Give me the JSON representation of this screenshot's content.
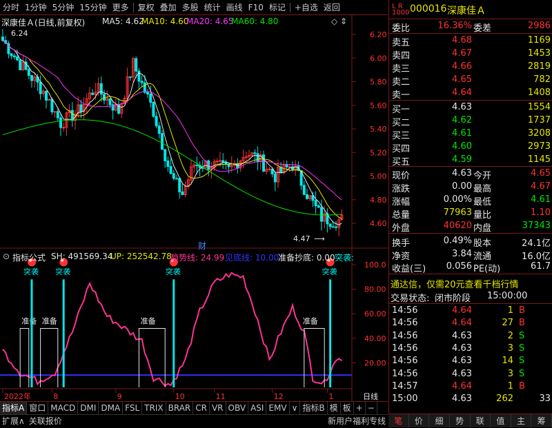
{
  "toolbar": {
    "items": [
      "分时",
      "1分钟",
      "5分钟",
      "15分钟",
      "更多",
      "复权",
      "叠加",
      "多股",
      "统计",
      "画线",
      "F10",
      "标记",
      "+自选",
      "返回"
    ]
  },
  "main_chart": {
    "title": "深康佳Ａ(日线,前复权)",
    "ma5": "MA5: 4.62",
    "ma10": "MA10: 4.60",
    "ma20": "MA20: 4.65",
    "ma60": "MA60: 4.80",
    "high_marker": "6.24",
    "low_marker": "4.47",
    "fin_marker": "财",
    "y_ticks": [
      "6.20",
      "6.00",
      "5.80",
      "5.60",
      "5.40",
      "5.20",
      "5.00",
      "4.80",
      "4.60"
    ]
  },
  "indicator": {
    "name": "指标公式",
    "sh": "SH: 491569.34",
    "up": "UP: 252542.78",
    "trend": "趋势线: 24.99",
    "bottom": "见底线: 10.00",
    "prep": "准备抄底: 0.00",
    "breakout": "突袭:",
    "signal_breakout": "突袭",
    "signal_prep": "准备",
    "y_ticks": [
      "100.0",
      "80.00",
      "60.00",
      "40.00",
      "20.00"
    ]
  },
  "x_axis": {
    "labels": [
      "2022年",
      "8",
      "9",
      "10",
      "11",
      "12",
      "1"
    ],
    "period": "日线"
  },
  "tabs_row1": [
    "指标A",
    "窗口",
    "MACD",
    "DMI",
    "DMA",
    "FSL",
    "TRIX",
    "BRAR",
    "CR",
    "VR",
    "OBV",
    "ASI",
    "EMV",
    "∨",
    "指标B",
    "模",
    "板",
    "+",
    "−"
  ],
  "tabs_row2": [
    "扩展∧",
    "关联报价",
    "新用户福利专线"
  ],
  "panel": {
    "code": "000016",
    "name": "深康佳Ａ",
    "weibi_label": "委比",
    "weibi": "16.36%",
    "weicha_label": "委差",
    "weicha": "2986",
    "sells": [
      {
        "label": "卖五",
        "price": "4.68",
        "vol": "1169"
      },
      {
        "label": "卖四",
        "price": "4.67",
        "vol": "1453"
      },
      {
        "label": "卖三",
        "price": "4.66",
        "vol": "2819"
      },
      {
        "label": "卖二",
        "price": "4.65",
        "vol": "782"
      },
      {
        "label": "卖一",
        "price": "4.64",
        "vol": "1408"
      }
    ],
    "buys": [
      {
        "label": "买一",
        "price": "4.63",
        "vol": "1554"
      },
      {
        "label": "买二",
        "price": "4.62",
        "vol": "1737"
      },
      {
        "label": "买三",
        "price": "4.61",
        "vol": "3208"
      },
      {
        "label": "买四",
        "price": "4.60",
        "vol": "2973"
      },
      {
        "label": "买五",
        "price": "4.59",
        "vol": "1145"
      }
    ],
    "stats": [
      {
        "l1": "现价",
        "v1": "4.63",
        "l2": "今开",
        "v2": "4.65"
      },
      {
        "l1": "涨跌",
        "v1": "0.00",
        "l2": "最高",
        "v2": "4.67"
      },
      {
        "l1": "涨幅",
        "v1": "0.00%",
        "l2": "最低",
        "v2": "4.61"
      },
      {
        "l1": "总量",
        "v1": "77963",
        "l2": "量比",
        "v2": "1.10"
      },
      {
        "l1": "外盘",
        "v1": "40620",
        "l2": "内盘",
        "v2": "37343"
      }
    ],
    "stats2": [
      {
        "l1": "换手",
        "v1": "0.49%",
        "l2": "股本",
        "v2": "24.1亿"
      },
      {
        "l1": "净资",
        "v1": "3.84",
        "l2": "流通",
        "v2": "16.0亿"
      },
      {
        "l1": "收益(三)",
        "v1": "0.056",
        "l2": "PE(动)",
        "v2": "61.7"
      }
    ],
    "promo": "通达信，仅需20元查看千档行情",
    "trade_status_label": "交易状态:",
    "trade_status": "闭市阶段",
    "trade_time": "15:00:00",
    "ticks": [
      {
        "t": "14:56",
        "p": "4.64",
        "v": "1",
        "d": "B"
      },
      {
        "t": "14:56",
        "p": "4.64",
        "v": "27",
        "d": "B"
      },
      {
        "t": "14:56",
        "p": "4.63",
        "v": "2",
        "d": "S"
      },
      {
        "t": "14:56",
        "p": "4.63",
        "v": "3",
        "d": "S"
      },
      {
        "t": "14:56",
        "p": "4.63",
        "v": "14",
        "d": "S"
      },
      {
        "t": "14:56",
        "p": "4.63",
        "v": "3",
        "d": "S"
      },
      {
        "t": "14:57",
        "p": "4.64",
        "v": "1",
        "d": "B"
      },
      {
        "t": "15:00",
        "p": "4.63",
        "v": "262",
        "d": "33"
      }
    ],
    "nav": [
      "笔",
      "价",
      "细",
      "势",
      "联",
      "值",
      "主",
      "筹"
    ]
  }
}
